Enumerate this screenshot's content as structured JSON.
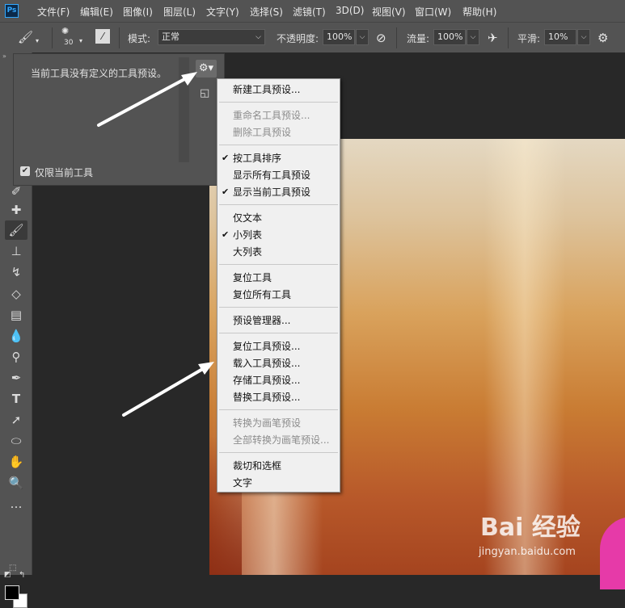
{
  "app": {
    "logo_text": "Ps"
  },
  "menubar": {
    "items": [
      "文件(F)",
      "编辑(E)",
      "图像(I)",
      "图层(L)",
      "文字(Y)",
      "选择(S)",
      "滤镜(T)",
      "3D(D)",
      "视图(V)",
      "窗口(W)",
      "帮助(H)"
    ]
  },
  "options": {
    "brush_size": "30",
    "mode_label": "模式:",
    "mode_value": "正常",
    "opacity_label": "不透明度:",
    "opacity_value": "100%",
    "flow_label": "流量:",
    "flow_value": "100%",
    "smoothing_label": "平滑:",
    "smoothing_value": "10%"
  },
  "presets_panel": {
    "empty_message": "当前工具没有定义的工具预设。",
    "only_current_label": "仅限当前工具",
    "only_current_checked": true
  },
  "context_menu": {
    "new_preset": "新建工具预设...",
    "rename_preset": "重命名工具预设...",
    "delete_preset": "删除工具预设",
    "sort_by_tool": "按工具排序",
    "show_all": "显示所有工具预设",
    "show_current": "显示当前工具预设",
    "text_only": "仅文本",
    "small_list": "小列表",
    "large_list": "大列表",
    "reset_tool": "复位工具",
    "reset_all_tools": "复位所有工具",
    "preset_manager": "预设管理器...",
    "reset_presets": "复位工具预设...",
    "load_presets": "载入工具预设...",
    "save_presets": "存储工具预设...",
    "replace_presets": "替换工具预设...",
    "convert_to_brush": "转换为画笔预设",
    "convert_all_to_brush": "全部转换为画笔预设...",
    "crop_and_marquee": "裁切和选框",
    "text": "文字"
  },
  "watermark": {
    "logo": "Bai 经验",
    "url": "jingyan.baidu.com"
  },
  "colors": {
    "menu_bg": "#535353",
    "canvas_bg": "#282828",
    "menu_popup_bg": "#f0f0f0",
    "accent_ps": "#31a8ff"
  }
}
